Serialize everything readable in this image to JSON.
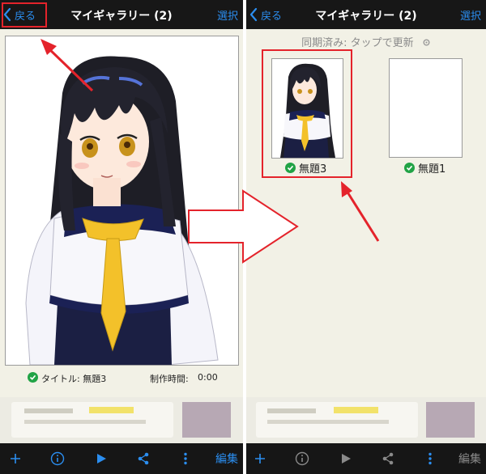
{
  "left": {
    "nav": {
      "back_label": "戻る",
      "title": "マイギャラリー (2)",
      "select_label": "選択"
    },
    "info": {
      "title_text": "タイトル: 無題3",
      "time_label": "制作時間:",
      "time_value": "0:00"
    },
    "toolbar": {
      "edit_label": "編集",
      "icons": [
        "plus-icon",
        "info-icon",
        "play-icon",
        "share-icon",
        "more-icon"
      ]
    }
  },
  "right": {
    "nav": {
      "back_label": "戻る",
      "title": "マイギャラリー (2)",
      "select_label": "選択"
    },
    "sync_status": "同期済み: タップで更新",
    "items": [
      {
        "name": "無題3",
        "synced": true
      },
      {
        "name": "無題1",
        "synced": true
      }
    ],
    "toolbar": {
      "edit_label": "編集",
      "icons": [
        "plus-icon",
        "info-icon",
        "play-icon",
        "share-icon",
        "more-icon"
      ]
    }
  },
  "colors": {
    "accent": "#2b8ef0",
    "navbar": "#171717",
    "background": "#f2f1e6",
    "highlight": "#e4232b",
    "check": "#21a346"
  }
}
